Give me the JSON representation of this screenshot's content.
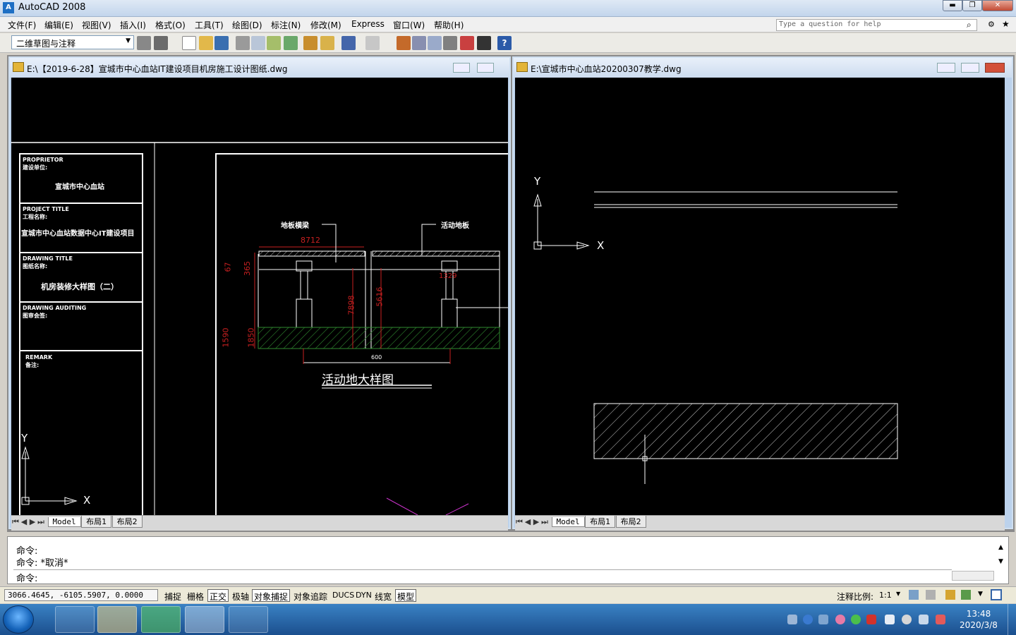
{
  "app": {
    "title": "AutoCAD 2008",
    "icon": "autocad-icon"
  },
  "window_controls": {
    "minimize": "▬",
    "restore": "❐",
    "close": "✕"
  },
  "menu": [
    "文件(F)",
    "编辑(E)",
    "视图(V)",
    "插入(I)",
    "格式(O)",
    "工具(T)",
    "绘图(D)",
    "标注(N)",
    "修改(M)",
    "Express",
    "窗口(W)",
    "帮助(H)"
  ],
  "help": {
    "placeholder": "Type a question for help"
  },
  "toolbar": {
    "workspace": "二维草图与注释",
    "help_button": "?"
  },
  "left_window": {
    "title": "E:\\【2019-6-28】宣城市中心血站IT建设项目机房施工设计图纸.dwg",
    "titleblock": {
      "proprietor_en": "PROPRIETOR",
      "proprietor_cn": "建设单位:",
      "proprietor_value": "宣城市中心血站",
      "project_en": "PROJECT TITLE",
      "project_cn": "工程名称:",
      "project_value": "宣城市中心血站数据中心IT建设项目",
      "drawing_en": "DRAWING TITLE",
      "drawing_cn": "图纸名称:",
      "drawing_value": "机房装修大样图（二）",
      "auditing_en": "DRAWING AUDITING",
      "auditing_cn": "图审会签:",
      "remark_en": "REMARK",
      "remark_cn": "备注:"
    },
    "detail": {
      "label_left": "地板横梁",
      "label_right": "活动地板",
      "dim_top": "8712",
      "dim_a": "67",
      "dim_b": "365",
      "dim_c": "7898",
      "dim_d": "5616",
      "dim_e": "1590",
      "dim_f": "1850",
      "dim_g": "1329",
      "dim_bottom": "600",
      "title": "活动地大样图"
    },
    "tabs": [
      "Model",
      "布局1",
      "布局2"
    ]
  },
  "right_window": {
    "title": "E:\\宣城市中心血站20200307教学.dwg",
    "tabs": [
      "Model",
      "布局1",
      "布局2"
    ]
  },
  "ucs": {
    "x": "X",
    "y": "Y"
  },
  "command": {
    "line1": "命令:",
    "line2": "命令: *取消*",
    "line3": "命令:"
  },
  "status": {
    "coords": "3066.4645,  -6105.5907, 0.0000",
    "toggles": [
      {
        "label": "捕捉",
        "on": false
      },
      {
        "label": "栅格",
        "on": false
      },
      {
        "label": "正交",
        "on": true
      },
      {
        "label": "极轴",
        "on": false
      },
      {
        "label": "对象捕捉",
        "on": true
      },
      {
        "label": "对象追踪",
        "on": false
      },
      {
        "label": "DUCS",
        "on": false
      },
      {
        "label": "DYN",
        "on": false
      },
      {
        "label": "线宽",
        "on": false
      },
      {
        "label": "模型",
        "on": true
      }
    ],
    "annotation_label": "注释比例:",
    "annotation_scale": "1:1"
  },
  "taskbar": {
    "time": "13:48",
    "date": "2020/3/8",
    "apps": [
      "explorer-icon",
      "folder-icon",
      "wechat-icon",
      "autocad-icon",
      "notebook-icon"
    ]
  },
  "colors": {
    "canvas": "#000000",
    "dimension": "#c82020",
    "hatch": "#2f8a2f",
    "accent": "#1e6fc4"
  }
}
